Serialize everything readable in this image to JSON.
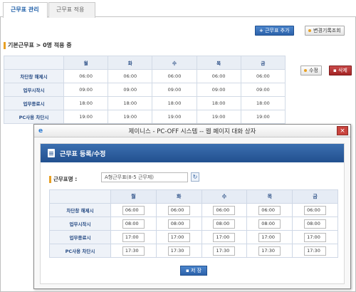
{
  "tabs": [
    {
      "label": "근무표 관리",
      "active": true
    },
    {
      "label": "근무표 적용",
      "active": false
    }
  ],
  "toolbar": {
    "add_label": "근무표 추가",
    "history_label": "변경기록조회"
  },
  "section": {
    "title": "기본근무표  >  0명 적용 중"
  },
  "actions": {
    "edit_label": "수정",
    "delete_label": "삭제"
  },
  "days": [
    "월",
    "화",
    "수",
    "목",
    "금"
  ],
  "background_table": {
    "rows": [
      {
        "label": "차단창 해제시",
        "values": [
          "06:00",
          "06:00",
          "06:00",
          "06:00",
          "06:00"
        ]
      },
      {
        "label": "업무시작시",
        "values": [
          "09:00",
          "09:00",
          "09:00",
          "09:00",
          "09:00"
        ]
      },
      {
        "label": "업무종료시",
        "values": [
          "18:00",
          "18:00",
          "18:00",
          "18:00",
          "18:00"
        ]
      },
      {
        "label": "PC사용 차단시",
        "values": [
          "19:00",
          "19:00",
          "19:00",
          "19:00",
          "19:00"
        ]
      }
    ]
  },
  "dialog": {
    "title": "제이니스 - PC-OFF 시스템 -- 웹 페이지 대화 상자",
    "close": "×",
    "header": "근무표 등록/수정",
    "name_label": "근무표명 :",
    "name_value": "A형근무표(8-5 근무제)",
    "rows": [
      {
        "label": "차단창 해제시",
        "values": [
          "06:00",
          "06:00",
          "06:00",
          "06:00",
          "06:00"
        ]
      },
      {
        "label": "업무시작시",
        "values": [
          "08:00",
          "08:00",
          "08:00",
          "08:00",
          "08:00"
        ]
      },
      {
        "label": "업무종료시",
        "values": [
          "17:00",
          "17:00",
          "17:00",
          "17:00",
          "17:00"
        ]
      },
      {
        "label": "PC사용 차단시",
        "values": [
          "17:30",
          "17:30",
          "17:30",
          "17:30",
          "17:30"
        ]
      }
    ],
    "save_label": "저 장"
  },
  "icons": {
    "ie": "e",
    "refresh": "↻"
  }
}
